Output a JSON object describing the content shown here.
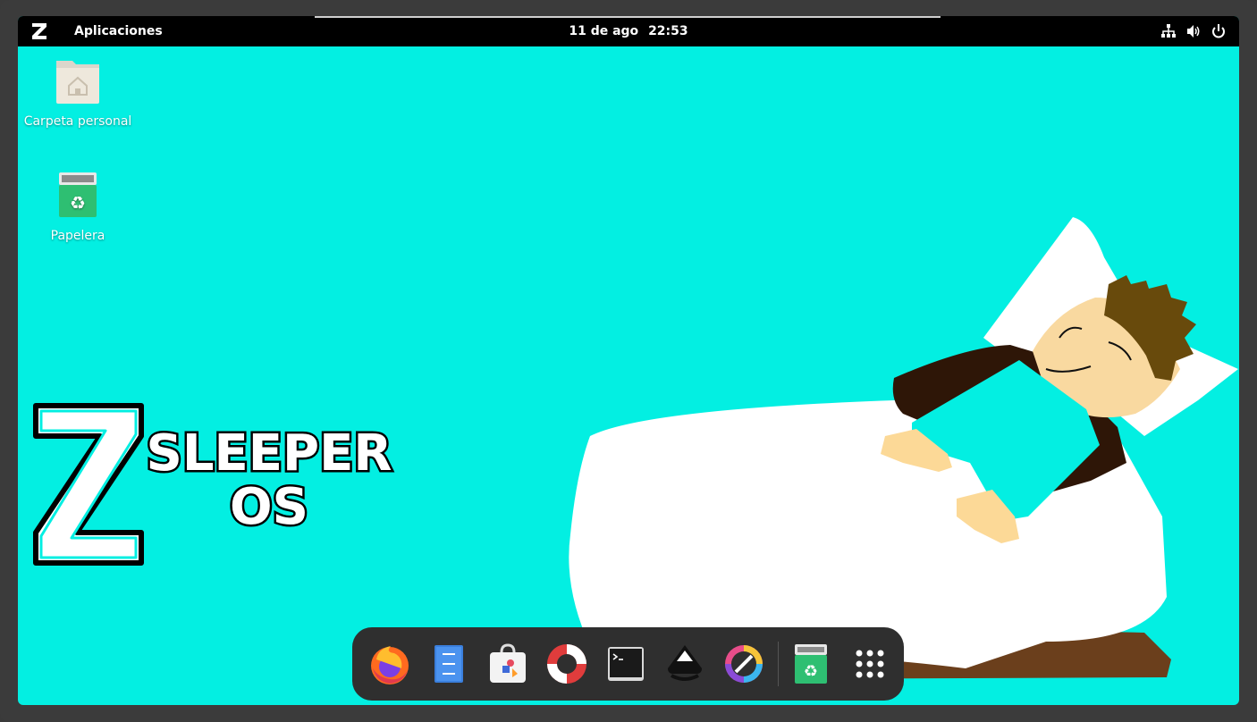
{
  "topbar": {
    "apps_label": "Aplicaciones",
    "date": "11 de ago",
    "time": "22:53",
    "tray_icons": [
      "network-icon",
      "volume-icon",
      "power-icon"
    ]
  },
  "desktop": {
    "background_color": "#03efe2",
    "icons": [
      {
        "label": "Carpeta personal",
        "icon": "home-folder-icon"
      },
      {
        "label": "Papelera",
        "icon": "trash-icon"
      }
    ],
    "brand": {
      "line1": "SLEEPER",
      "line2": "OS",
      "logo_letter": "Z"
    }
  },
  "dock": {
    "items": [
      {
        "name": "firefox",
        "icon": "firefox-icon"
      },
      {
        "name": "files",
        "icon": "files-icon"
      },
      {
        "name": "software",
        "icon": "software-store-icon"
      },
      {
        "name": "help",
        "icon": "help-lifebuoy-icon"
      },
      {
        "name": "terminal",
        "icon": "terminal-icon"
      },
      {
        "name": "inkscape",
        "icon": "inkscape-icon"
      },
      {
        "name": "krita",
        "icon": "krita-icon"
      },
      {
        "name": "trash",
        "icon": "trash-icon"
      },
      {
        "name": "app-grid",
        "icon": "app-grid-icon"
      }
    ]
  }
}
